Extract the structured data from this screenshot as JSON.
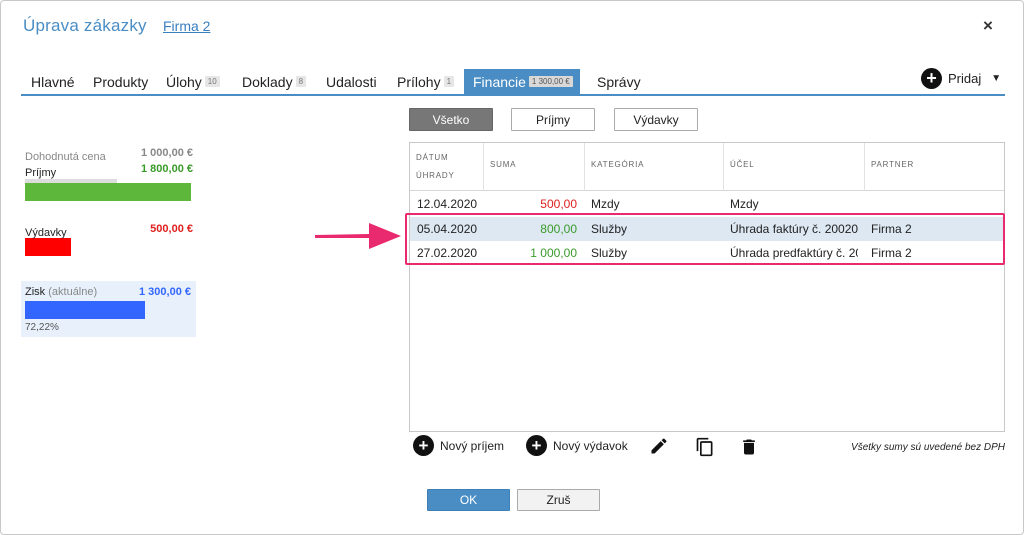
{
  "header": {
    "title": "Úprava zákazky",
    "link": "Firma 2",
    "close": "×"
  },
  "tabs": [
    {
      "label": "Hlavné",
      "badge": ""
    },
    {
      "label": "Produkty",
      "badge": ""
    },
    {
      "label": "Úlohy",
      "badge": "10"
    },
    {
      "label": "Doklady",
      "badge": "8"
    },
    {
      "label": "Udalosti",
      "badge": ""
    },
    {
      "label": "Prílohy",
      "badge": "1"
    },
    {
      "label": "Financie",
      "badge": "1 300,00 €"
    },
    {
      "label": "Správy",
      "badge": ""
    }
  ],
  "add_menu": {
    "label": "Pridaj",
    "plus": "+",
    "caret": "▼"
  },
  "summary": {
    "agreed_label": "Dohodnutá cena",
    "agreed_value": "1 000,00 €",
    "income_label": "Príjmy",
    "income_value": "1 800,00 €",
    "expense_label": "Výdavky",
    "expense_value": "500,00 €",
    "profit_label": "Zisk",
    "profit_sub": "(aktuálne)",
    "profit_value": "1 300,00 €",
    "profit_pct": "72,22%",
    "colors": {
      "income": "#5db73a",
      "expense": "#ff0000",
      "profit": "#3366ff",
      "agreed": "#888888"
    }
  },
  "filters": [
    {
      "label": "Všetko",
      "active": true
    },
    {
      "label": "Príjmy",
      "active": false
    },
    {
      "label": "Výdavky",
      "active": false
    }
  ],
  "grid": {
    "columns": [
      "DÁTUM ÚHRADY",
      "SUMA",
      "KATEGÓRIA",
      "ÚČEL",
      "PARTNER"
    ],
    "col_date_1": "DÁTUM",
    "col_date_2": "ÚHRADY",
    "rows": [
      {
        "date": "12.04.2020",
        "amount": "500,00",
        "category": "Mzdy",
        "purpose": "Mzdy",
        "partner": "",
        "amount_color": "#e02020"
      },
      {
        "date": "05.04.2020",
        "amount": "800,00",
        "category": "Služby",
        "purpose": "Úhrada faktúry č. 20020…",
        "partner": "Firma 2",
        "amount_color": "#3a9a2a"
      },
      {
        "date": "27.02.2020",
        "amount": "1 000,00",
        "category": "Služby",
        "purpose": "Úhrada predfaktúry č. 20…",
        "partner": "Firma 2",
        "amount_color": "#3a9a2a"
      }
    ]
  },
  "toolbar": {
    "new_income": "Nový príjem",
    "new_expense": "Nový výdavok",
    "note": "Všetky sumy sú uvedené bez DPH"
  },
  "footer": {
    "ok": "OK",
    "cancel": "Zruš"
  }
}
